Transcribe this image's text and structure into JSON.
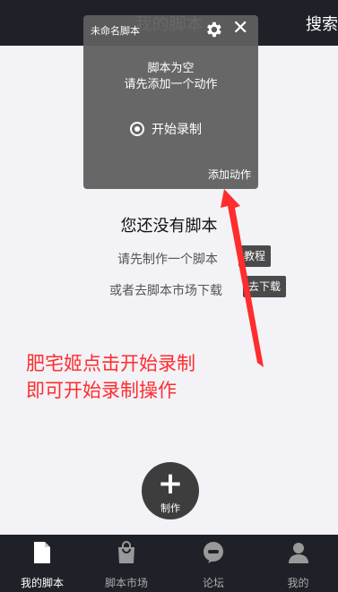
{
  "header": {
    "title": "我的脚本",
    "search_label": "搜索"
  },
  "panel": {
    "title": "未命名脚本",
    "message_line1": "脚本为空",
    "message_line2": "请先添加一个动作",
    "record_label": "开始录制",
    "add_action_label": "添加动作",
    "icons": [
      "gear-icon",
      "close-icon",
      "radio-icon"
    ]
  },
  "empty": {
    "title": "您还没有脚本",
    "line1": "请先制作一个脚本",
    "tutorial_button": "教程",
    "line2": "或者去脚本市场下载",
    "download_button": "去下载"
  },
  "annotation": {
    "line1": "肥宅姬点击开始录制",
    "line2": "即可开始录制操作",
    "color": "#ff2d2d"
  },
  "fab": {
    "label": "制作",
    "icon": "plus-icon"
  },
  "bottom_nav": [
    {
      "label": "我的脚本",
      "icon": "document-icon",
      "active": true
    },
    {
      "label": "脚本市场",
      "icon": "shopping-bag-icon",
      "active": false
    },
    {
      "label": "论坛",
      "icon": "chat-icon",
      "active": false
    },
    {
      "label": "我的",
      "icon": "person-icon",
      "active": false
    }
  ],
  "colors": {
    "bar": "#1e2128",
    "background": "#f2f2f7",
    "panel": "#5f5f5f",
    "accent_red": "#ff2d2d"
  }
}
